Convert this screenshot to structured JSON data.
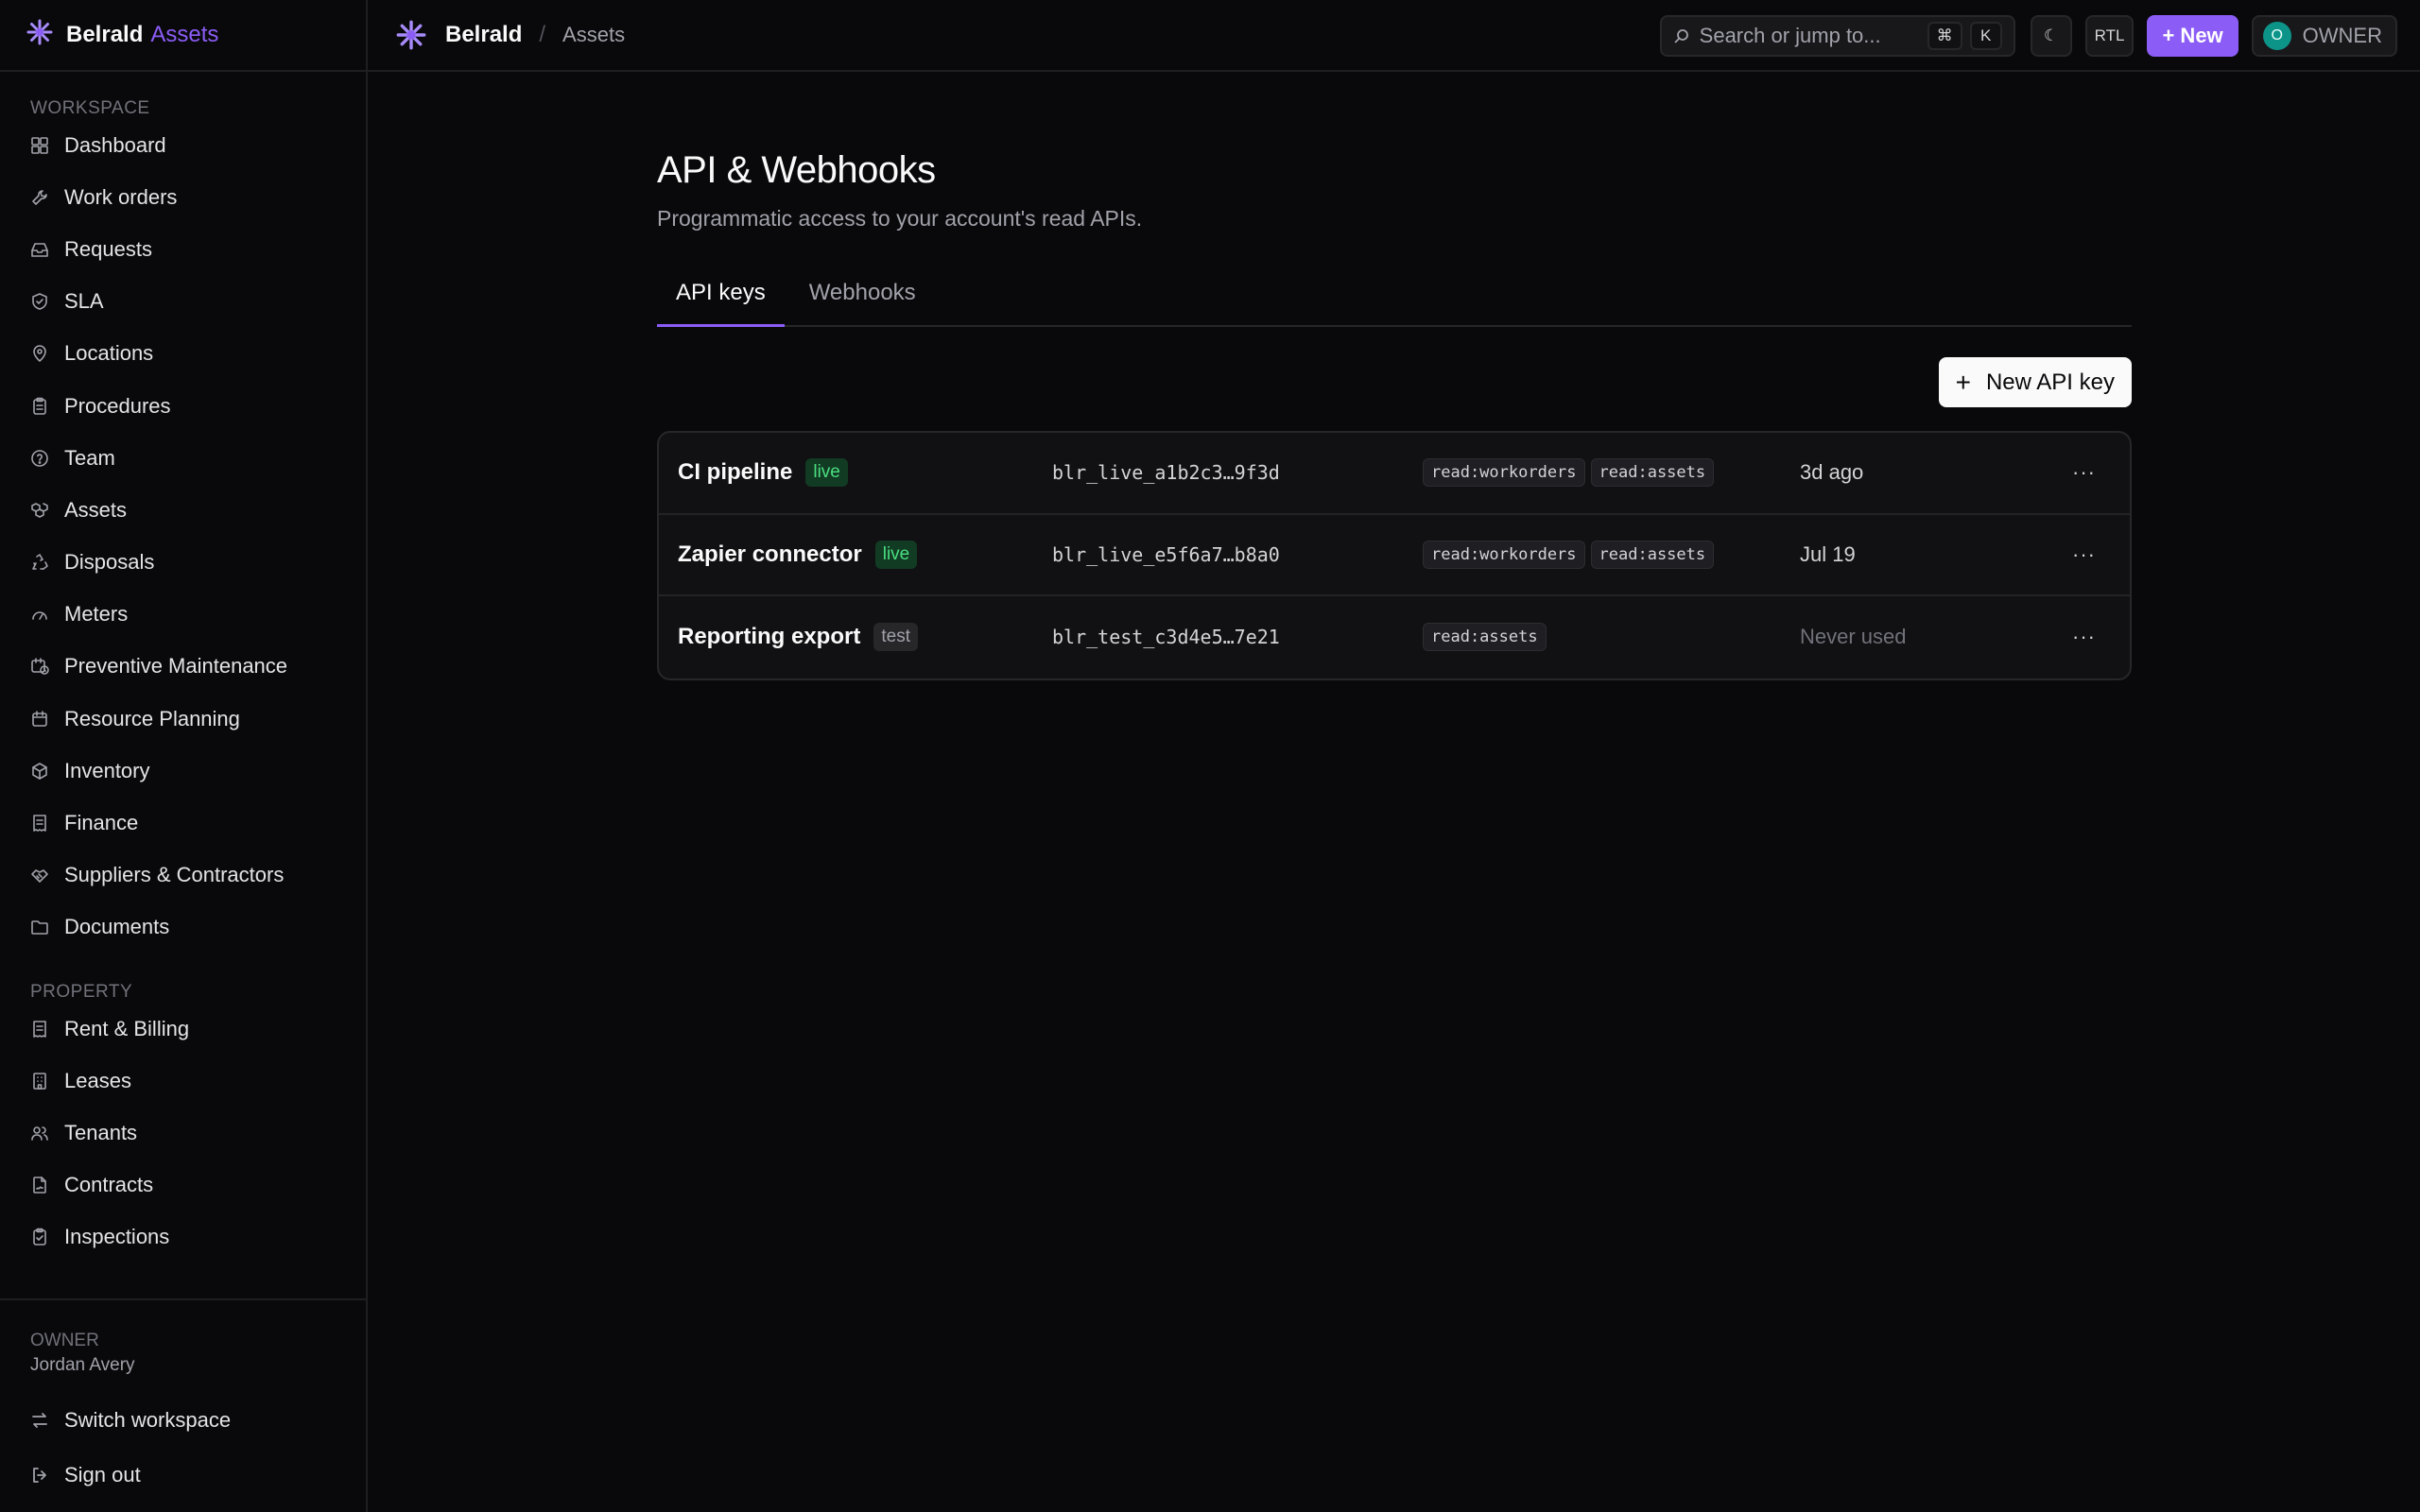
{
  "brand": {
    "name": "Belrald",
    "product": "Assets"
  },
  "topbar": {
    "crumb_main": "Belrald",
    "crumb_sep": "/",
    "crumb_sub": "Assets",
    "search_placeholder": "Search or jump to...",
    "kbd_cmd": "⌘",
    "kbd_k": "K",
    "theme_icon": "☾",
    "rtl_label": "RTL",
    "new_label": "+ New",
    "avatar_initial": "O",
    "role_label": "OWNER"
  },
  "sidebar": {
    "workspace_label": "WORKSPACE",
    "workspace_items": [
      {
        "label": "Dashboard",
        "icon": "grid-icon"
      },
      {
        "label": "Work orders",
        "icon": "wrench-icon"
      },
      {
        "label": "Requests",
        "icon": "inbox-icon"
      },
      {
        "label": "SLA",
        "icon": "shield-check-icon"
      },
      {
        "label": "Locations",
        "icon": "map-pin-icon"
      },
      {
        "label": "Procedures",
        "icon": "clipboard-icon"
      },
      {
        "label": "Team",
        "icon": "help-circle-icon"
      },
      {
        "label": "Assets",
        "icon": "boxes-icon"
      },
      {
        "label": "Disposals",
        "icon": "recycle-icon"
      },
      {
        "label": "Meters",
        "icon": "gauge-icon"
      },
      {
        "label": "Preventive Maintenance",
        "icon": "calendar-clock-icon"
      },
      {
        "label": "Resource Planning",
        "icon": "calendar-icon"
      },
      {
        "label": "Inventory",
        "icon": "package-icon"
      },
      {
        "label": "Finance",
        "icon": "receipt-icon"
      },
      {
        "label": "Suppliers & Contractors",
        "icon": "handshake-icon"
      },
      {
        "label": "Documents",
        "icon": "folder-icon"
      }
    ],
    "property_label": "PROPERTY",
    "property_items": [
      {
        "label": "Rent & Billing",
        "icon": "receipt-icon"
      },
      {
        "label": "Leases",
        "icon": "building-icon"
      },
      {
        "label": "Tenants",
        "icon": "users-icon"
      },
      {
        "label": "Contracts",
        "icon": "file-signature-icon"
      },
      {
        "label": "Inspections",
        "icon": "clipboard-check-icon"
      }
    ],
    "footer": {
      "role": "OWNER",
      "user": "Jordan Avery",
      "switch_label": "Switch workspace",
      "signout_label": "Sign out"
    }
  },
  "main": {
    "title": "API & Webhooks",
    "subtitle": "Programmatic access to your account's read APIs.",
    "tabs": [
      {
        "label": "API keys",
        "active": true
      },
      {
        "label": "Webhooks",
        "active": false
      }
    ],
    "new_key_label": "New API key",
    "keys": [
      {
        "name": "CI pipeline",
        "env": "live",
        "token": "blr_live_a1b2c3…9f3d",
        "scopes": [
          "read:workorders",
          "read:assets"
        ],
        "last_used": "3d ago",
        "muted": false
      },
      {
        "name": "Zapier connector",
        "env": "live",
        "token": "blr_live_e5f6a7…b8a0",
        "scopes": [
          "read:workorders",
          "read:assets"
        ],
        "last_used": "Jul 19",
        "muted": false
      },
      {
        "name": "Reporting export",
        "env": "test",
        "token": "blr_test_c3d4e5…7e21",
        "scopes": [
          "read:assets"
        ],
        "last_used": "Never used",
        "muted": true
      }
    ],
    "row_menu": "···"
  },
  "colors": {
    "accent": "#8b5cf6",
    "live": "#4ade80",
    "background": "#09090b"
  }
}
